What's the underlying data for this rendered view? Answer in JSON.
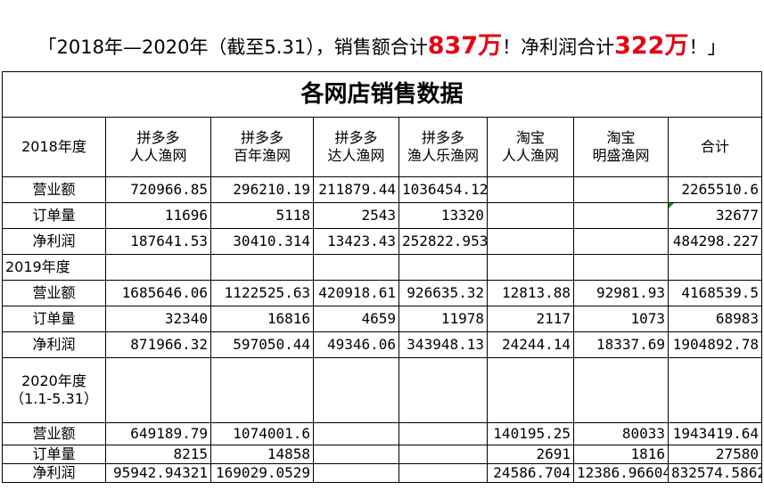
{
  "headline": {
    "prefix": "「2018年—2020年（截至5.31），销售额合计",
    "sales_total": "837万",
    "middle": "！净利润合计",
    "profit_total": "322万",
    "suffix": "！」"
  },
  "table": {
    "title": "各网店销售数据",
    "columns": [
      {
        "line1": "拼多多",
        "line2": "人人渔网"
      },
      {
        "line1": "拼多多",
        "line2": "百年渔网"
      },
      {
        "line1": "拼多多",
        "line2": "达人渔网"
      },
      {
        "line1": "拼多多",
        "line2": "渔人乐渔网"
      },
      {
        "line1": "淘宝",
        "line2": "人人渔网"
      },
      {
        "line1": "淘宝",
        "line2": "明盛渔网"
      }
    ],
    "total_label": "合计",
    "y2018": {
      "label": "2018年度",
      "sales": {
        "label": "营业额",
        "values": [
          "720966.85",
          "296210.19",
          "211879.44",
          "1036454.12",
          "",
          ""
        ],
        "total": "2265510.6"
      },
      "orders": {
        "label": "订单量",
        "values": [
          "11696",
          "5118",
          "2543",
          "13320",
          "",
          ""
        ],
        "total": "32677"
      },
      "profit": {
        "label": "净利润",
        "values": [
          "187641.53",
          "30410.314",
          "13423.43",
          "252822.953",
          "",
          ""
        ],
        "total": "484298.227"
      }
    },
    "y2019": {
      "label": "2019年度",
      "sales": {
        "label": "营业额",
        "values": [
          "1685646.06",
          "1122525.63",
          "420918.61",
          "926635.32",
          "12813.88",
          "92981.93"
        ],
        "total": "4168539.5"
      },
      "orders": {
        "label": "订单量",
        "values": [
          "32340",
          "16816",
          "4659",
          "11978",
          "2117",
          "1073"
        ],
        "total": "68983"
      },
      "profit": {
        "label": "净利润",
        "values": [
          "871966.32",
          "597050.44",
          "49346.06",
          "343948.13",
          "24244.14",
          "18337.69"
        ],
        "total": "1904892.78"
      }
    },
    "y2020": {
      "label": "2020年度",
      "sublabel": "（1.1-5.31）",
      "sales": {
        "label": "营业额",
        "values": [
          "649189.79",
          "1074001.6",
          "",
          "",
          "140195.25",
          "80033"
        ],
        "total": "1943419.64"
      },
      "orders": {
        "label": "订单量",
        "values": [
          "8215",
          "14858",
          "",
          "",
          "2691",
          "1816"
        ],
        "total": "27580"
      },
      "profit": {
        "label": "净利润",
        "values": [
          "95942.94321",
          "169029.0529",
          "",
          "",
          "24586.704",
          "12386.96604"
        ],
        "total": "832574.5862"
      }
    }
  }
}
